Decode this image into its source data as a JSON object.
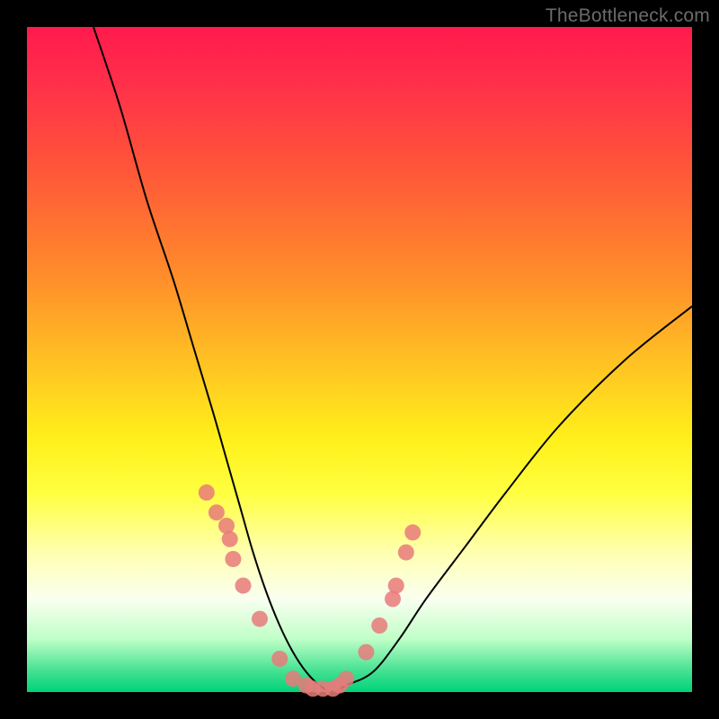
{
  "watermark": "TheBottleneck.com",
  "chart_data": {
    "type": "line",
    "title": "",
    "xlabel": "",
    "ylabel": "",
    "xlim": [
      0,
      100
    ],
    "ylim": [
      0,
      100
    ],
    "grid": false,
    "legend": false,
    "background_gradient": [
      "#ff1a4d",
      "#ffff40",
      "#00d27a"
    ],
    "series": [
      {
        "name": "bottleneck-curve",
        "color": "#000000",
        "x": [
          10,
          14,
          18,
          22,
          25,
          28,
          30,
          32,
          34,
          36,
          38,
          40,
          42,
          44,
          46,
          48,
          52,
          56,
          60,
          66,
          72,
          80,
          90,
          100
        ],
        "y": [
          100,
          88,
          74,
          62,
          52,
          42,
          35,
          28,
          21,
          15,
          10,
          6,
          3,
          1,
          0,
          1,
          3,
          8,
          14,
          22,
          30,
          40,
          50,
          58
        ]
      }
    ],
    "scatter_points": {
      "name": "highlighted-points",
      "color": "#e87a7a",
      "x": [
        27,
        28.5,
        30,
        30.5,
        31,
        32.5,
        35,
        38,
        40,
        42,
        43,
        44.5,
        46,
        47,
        48,
        51,
        53,
        55,
        55.5,
        57,
        58
      ],
      "y": [
        30,
        27,
        25,
        23,
        20,
        16,
        11,
        5,
        2,
        1,
        0.5,
        0.5,
        0.5,
        1,
        2,
        6,
        10,
        14,
        16,
        21,
        24
      ]
    }
  }
}
